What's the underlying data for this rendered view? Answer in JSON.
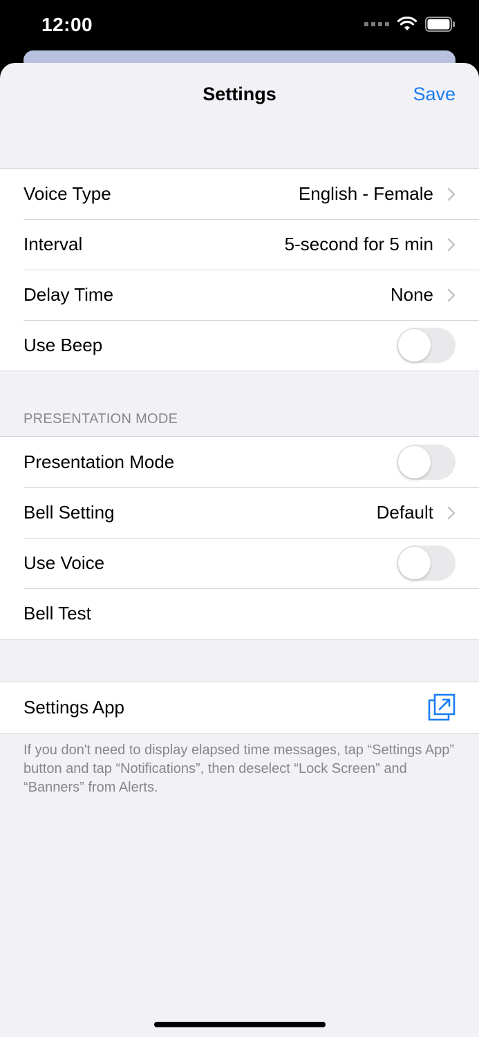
{
  "status_bar": {
    "time": "12:00"
  },
  "nav": {
    "title": "Settings",
    "save_label": "Save"
  },
  "group1": {
    "voice_type": {
      "label": "Voice Type",
      "value": "English - Female"
    },
    "interval": {
      "label": "Interval",
      "value": "5-second for 5 min"
    },
    "delay_time": {
      "label": "Delay Time",
      "value": "None"
    },
    "use_beep": {
      "label": "Use Beep",
      "on": false
    }
  },
  "presentation": {
    "header": "PRESENTATION MODE",
    "presentation_mode": {
      "label": "Presentation Mode",
      "on": false
    },
    "bell_setting": {
      "label": "Bell Setting",
      "value": "Default"
    },
    "use_voice": {
      "label": "Use Voice",
      "on": false
    },
    "bell_test": {
      "label": "Bell Test"
    }
  },
  "settings_app": {
    "label": "Settings App",
    "footer": "If you don't need to display elapsed time messages, tap “Settings App” button and tap “Notifications”, then deselect “Lock Screen” and “Banners” from Alerts."
  },
  "colors": {
    "accent": "#1a7cf3",
    "background": "#f1f1f6",
    "toggle_off": "#e9e9eb"
  }
}
